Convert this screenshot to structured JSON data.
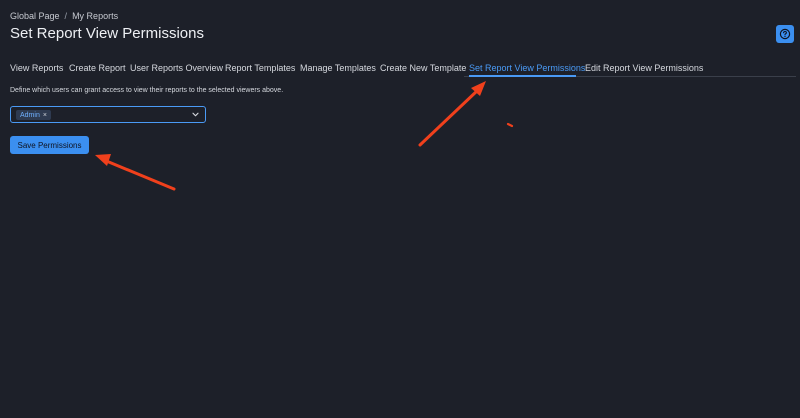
{
  "breadcrumb": {
    "items": [
      "Global Page",
      "My Reports"
    ],
    "separator": "/"
  },
  "header": {
    "title": "Set Report View Permissions",
    "help_icon": "question-circle-icon"
  },
  "tabs": [
    {
      "label": "View Reports",
      "active": false
    },
    {
      "label": "Create Report",
      "active": false
    },
    {
      "label": "User Reports Overview",
      "active": false
    },
    {
      "label": "Report Templates",
      "active": false
    },
    {
      "label": "Manage Templates",
      "active": false
    },
    {
      "label": "Create New Template",
      "active": false
    },
    {
      "label": "Set Report View Permissions",
      "active": true
    },
    {
      "label": "Edit Report View Permissions",
      "active": false
    }
  ],
  "form": {
    "description": "Define which users can grant access to view their reports to the selected viewers above.",
    "selected_chip": "Admin",
    "chip_remove": "×",
    "save_label": "Save Permissions"
  },
  "colors": {
    "background": "#1d2029",
    "accent": "#3b8ff0",
    "annotation_arrow": "#f0401c"
  }
}
